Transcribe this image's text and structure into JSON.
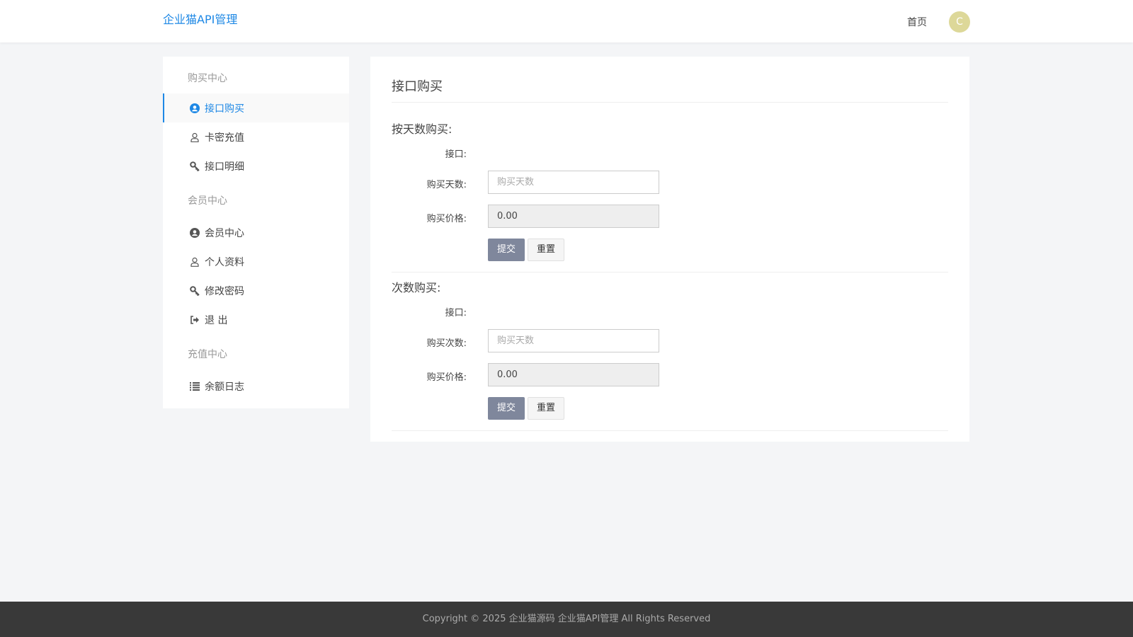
{
  "header": {
    "logo": "企业猫API管理",
    "home": "首页",
    "avatar_letter": "C"
  },
  "sidebar": {
    "sections": [
      {
        "title": "购买中心",
        "items": [
          {
            "label": "接口购买",
            "icon": "user-circle-icon",
            "active": true
          },
          {
            "label": "卡密充值",
            "icon": "user-icon"
          },
          {
            "label": "接口明细",
            "icon": "key-icon"
          }
        ]
      },
      {
        "title": "会员中心",
        "items": [
          {
            "label": "会员中心",
            "icon": "user-circle-icon"
          },
          {
            "label": "个人资料",
            "icon": "user-icon"
          },
          {
            "label": "修改密码",
            "icon": "key-icon"
          },
          {
            "label": "退 出",
            "icon": "sign-out-icon"
          }
        ]
      },
      {
        "title": "充值中心",
        "items": [
          {
            "label": "余额日志",
            "icon": "list-icon"
          }
        ]
      }
    ]
  },
  "main": {
    "title": "接口购买",
    "by_days": {
      "heading": "按天数购买:",
      "api_label": "接口:",
      "qty_label": "购买天数:",
      "qty_placeholder": "购买天数",
      "price_label": "购买价格:",
      "price_value": "0.00",
      "submit": "提交",
      "reset": "重置"
    },
    "by_count": {
      "heading": "次数购买:",
      "api_label": "接口:",
      "qty_label": "购买次数:",
      "qty_placeholder": "购买天数",
      "price_label": "购买价格:",
      "price_value": "0.00",
      "submit": "提交",
      "reset": "重置"
    }
  },
  "footer": {
    "text": "Copyright © 2025 企业猫源码 企业猫API管理 All Rights Reserved"
  }
}
